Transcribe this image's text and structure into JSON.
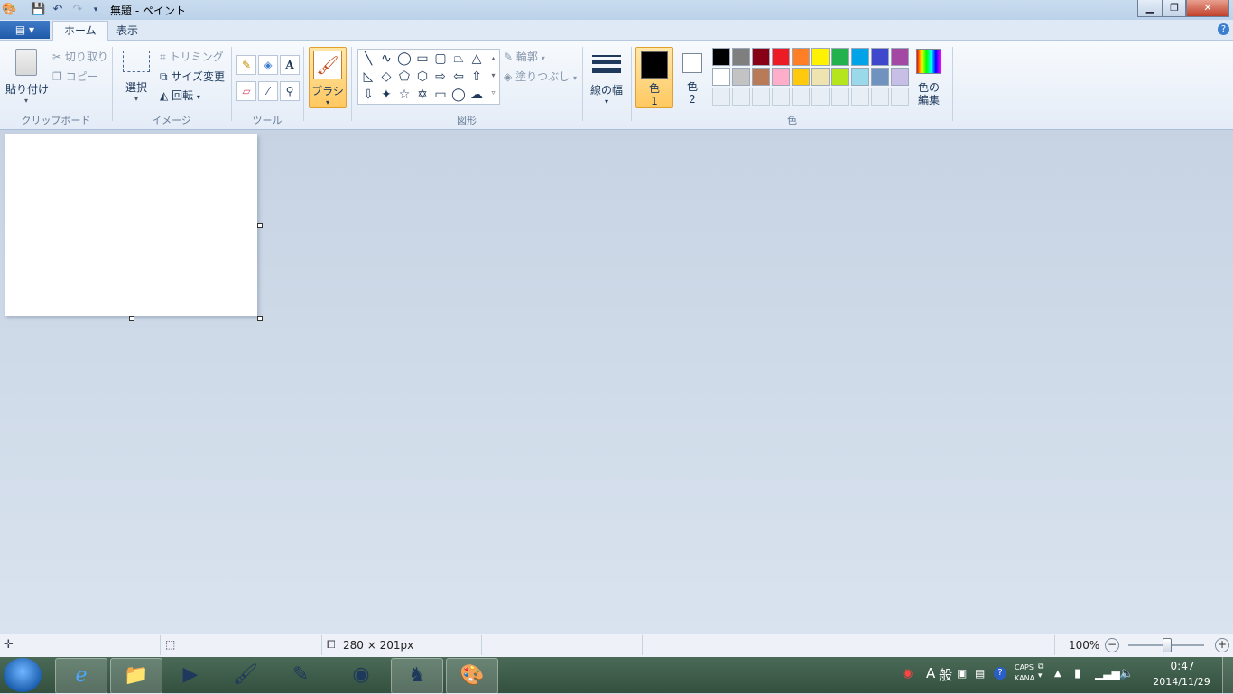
{
  "window": {
    "title": "無題 - ペイント"
  },
  "tabs": {
    "file": "▤ ▾",
    "home": "ホーム",
    "view": "表示"
  },
  "clipboard": {
    "paste": "貼り付け",
    "cut": "切り取り",
    "copy": "コピー",
    "group": "クリップボード"
  },
  "image": {
    "select": "選択",
    "crop": "トリミング",
    "resize": "サイズ変更",
    "rotate": "回転",
    "group": "イメージ"
  },
  "tools": {
    "group": "ツール",
    "pencil": "✎",
    "fill": "◈",
    "text": "A",
    "eraser": "▱",
    "picker": "⁄",
    "magnifier": "⚲"
  },
  "brush": {
    "label": "ブラシ"
  },
  "shapes": {
    "group": "図形",
    "outline": "輪郭",
    "fill": "塗りつぶし",
    "row1": [
      "╲",
      "∿",
      "◯",
      "▭",
      "▢",
      "⏢",
      "△"
    ],
    "row2": [
      "◺",
      "◇",
      "⬠",
      "⬡",
      "⇨",
      "⇦",
      "⇧"
    ],
    "row3": [
      "⇩",
      "✦",
      "☆",
      "✡",
      "▭",
      "◯",
      "☁"
    ]
  },
  "size": {
    "label": "線の幅"
  },
  "colors": {
    "group": "色",
    "color1": [
      "色",
      "1"
    ],
    "color2": [
      "色",
      "2"
    ],
    "edit": [
      "色の",
      "編集"
    ],
    "row1": [
      "#000000",
      "#7f7f7f",
      "#880015",
      "#ed1c24",
      "#ff7f27",
      "#fff200",
      "#22b14c",
      "#00a2e8",
      "#3f48cc",
      "#a349a4"
    ],
    "row2": [
      "#ffffff",
      "#c3c3c3",
      "#b97a57",
      "#ffaec9",
      "#ffc90e",
      "#efe4b0",
      "#b5e61d",
      "#99d9ea",
      "#7092be",
      "#c8bfe7"
    ],
    "primary": "#000000",
    "secondary": "#ffffff"
  },
  "status": {
    "dimensions": "280 × 201px",
    "zoom": "100%"
  },
  "tray": {
    "ime1": "A",
    "ime2": "般",
    "caps": "CAPS",
    "kana": "KANA",
    "time": "0:47",
    "date": "2014/11/29"
  }
}
